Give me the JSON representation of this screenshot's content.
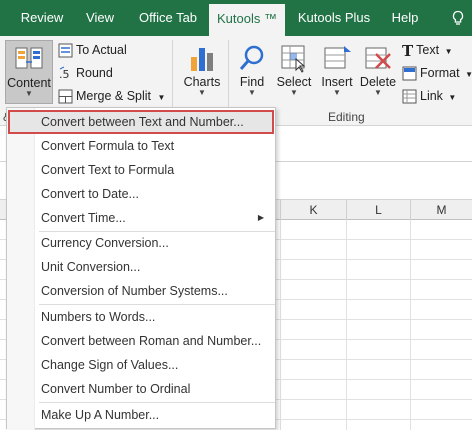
{
  "tabs": [
    {
      "label": "Review"
    },
    {
      "label": "View"
    },
    {
      "label": "Office Tab"
    },
    {
      "label": "Kutools ™"
    },
    {
      "label": "Kutools Plus"
    },
    {
      "label": "Help"
    }
  ],
  "active_tab": "Kutools ™",
  "colors": {
    "title_bar": "#217346",
    "highlight_border": "#d24b4b",
    "accent_blue": "#2e6fd1"
  },
  "ribbon": {
    "content_label": "Content",
    "to_actual": "To Actual",
    "round": "Round",
    "merge_split": "Merge & Split",
    "charts": "Charts",
    "find": "Find",
    "select": "Select",
    "insert": "Insert",
    "delete": "Delete",
    "text": "Text",
    "format": "Format",
    "link": "Link",
    "group_editing": "Editing",
    "group_left_fragment": "&"
  },
  "columns": [
    "K",
    "L",
    "M"
  ],
  "menu": {
    "items": [
      {
        "label": "Convert between Text and Number...",
        "highlighted": true
      },
      {
        "label": "Convert Formula to Text"
      },
      {
        "label": "Convert Text to Formula"
      },
      {
        "label": "Convert to Date..."
      },
      {
        "label": "Convert Time...",
        "submenu": true
      },
      {
        "label": "Currency Conversion..."
      },
      {
        "label": "Unit Conversion..."
      },
      {
        "label": "Conversion of Number Systems..."
      },
      {
        "label": "Numbers to Words..."
      },
      {
        "label": "Convert between Roman and Number..."
      },
      {
        "label": "Change Sign of Values..."
      },
      {
        "label": "Convert Number to Ordinal"
      },
      {
        "label": "Make Up A Number..."
      }
    ]
  }
}
